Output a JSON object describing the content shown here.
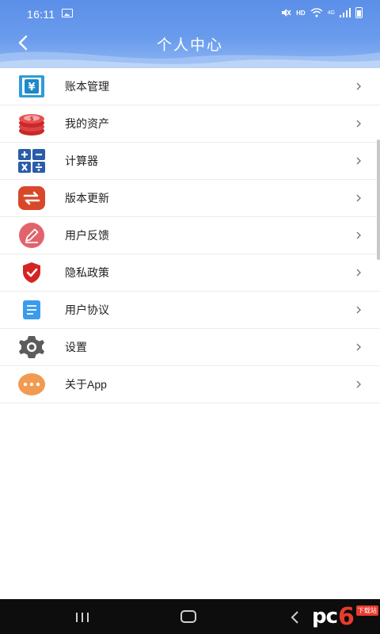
{
  "status_bar": {
    "time": "16:11",
    "hd": "HD",
    "network": "4G"
  },
  "header": {
    "title": "个人中心",
    "back_icon": "chevron-left-icon",
    "background": "#5b8fe8"
  },
  "menu": [
    {
      "label": "账本管理",
      "icon": "ledger-yen-icon"
    },
    {
      "label": "我的资产",
      "icon": "coins-stack-icon"
    },
    {
      "label": "计算器",
      "icon": "calculator-icon"
    },
    {
      "label": "版本更新",
      "icon": "update-arrows-icon"
    },
    {
      "label": "用户反馈",
      "icon": "pencil-feedback-icon"
    },
    {
      "label": "隐私政策",
      "icon": "shield-check-icon"
    },
    {
      "label": "用户协议",
      "icon": "document-icon"
    },
    {
      "label": "设置",
      "icon": "gear-icon"
    },
    {
      "label": "关于App",
      "icon": "more-dots-icon"
    }
  ],
  "watermark": {
    "pc": "pc",
    "six": "6",
    "sub": "下载站"
  }
}
